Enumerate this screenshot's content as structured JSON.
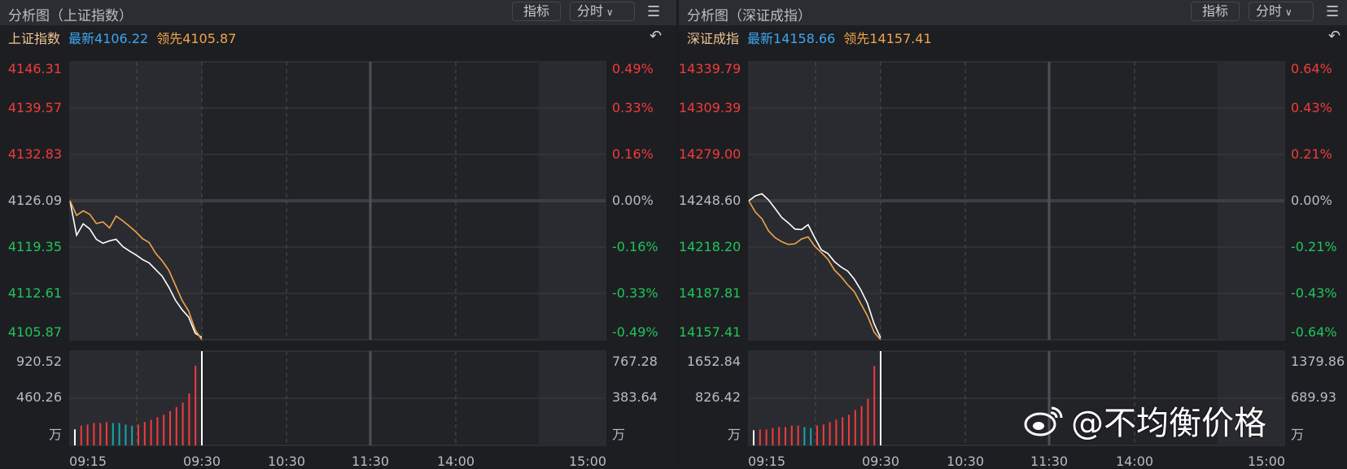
{
  "panels": [
    {
      "title": "分析图（上证指数）",
      "indicator_label": "指标",
      "period_label": "分时",
      "index_name": "上证指数",
      "latest_label": "最新4106.22",
      "leading_label": "领先4105.87",
      "price_ticks": [
        "4146.31",
        "4139.57",
        "4132.83",
        "4126.09",
        "4119.35",
        "4112.61",
        "4105.87"
      ],
      "pct_ticks": [
        "0.49%",
        "0.33%",
        "0.16%",
        "0.00%",
        "-0.16%",
        "-0.33%",
        "-0.49%"
      ],
      "vol_ticks_left": [
        "920.52",
        "460.26",
        "万"
      ],
      "vol_ticks_right": [
        "767.28",
        "383.64",
        "万"
      ]
    },
    {
      "title": "分析图（深证成指）",
      "indicator_label": "指标",
      "period_label": "分时",
      "index_name": "深证成指",
      "latest_label": "最新14158.66",
      "leading_label": "领先14157.41",
      "price_ticks": [
        "14339.79",
        "14309.39",
        "14279.00",
        "14248.60",
        "14218.20",
        "14187.81",
        "14157.41"
      ],
      "pct_ticks": [
        "0.64%",
        "0.43%",
        "0.21%",
        "0.00%",
        "-0.21%",
        "-0.43%",
        "-0.64%"
      ],
      "vol_ticks_left": [
        "1652.84",
        "826.42",
        "万"
      ],
      "vol_ticks_right": [
        "1379.86",
        "689.93",
        "万"
      ]
    }
  ],
  "time_labels": [
    "09:15",
    "09:30",
    "10:30",
    "11:30",
    "14:00",
    "15:00"
  ],
  "watermark": "@不均衡价格",
  "colors": {
    "latest": "#ffffff",
    "leading": "#f0a54a",
    "up": "#f23b3b",
    "down": "#1fc65a",
    "flat": "#12a8b0",
    "auction": "#ffffff"
  },
  "chart_data": [
    {
      "type": "line",
      "title": "上证指数",
      "x_unit": "auction step 09:15-09:30",
      "ylim": [
        4105.87,
        4146.31
      ],
      "base": 4126.09,
      "series": [
        {
          "name": "最新",
          "values": [
            4126.09,
            4121.08,
            4122.74,
            4121.99,
            4120.49,
            4119.9,
            4120.26,
            4120.49,
            4119.43,
            4118.8,
            4118.21,
            4117.54,
            4117.06,
            4116.08,
            4115.09,
            4113.51,
            4111.62,
            4110.24,
            4109.17,
            4106.81,
            4106.22
          ]
        },
        {
          "name": "领先",
          "values": [
            4126.09,
            4123.96,
            4124.63,
            4124.12,
            4122.78,
            4123.02,
            4122.15,
            4123.85,
            4123.18,
            4122.39,
            4121.56,
            4120.58,
            4120.02,
            4118.44,
            4117.34,
            4115.96,
            4113.79,
            4111.62,
            4110.04,
            4107.29,
            4105.87
          ]
        }
      ],
      "volume": {
        "ylim": [
          0,
          920.52
        ],
        "values": [
          157,
          192,
          203,
          219,
          219,
          227,
          219,
          219,
          203,
          192,
          203,
          229,
          251,
          275,
          299,
          336,
          374,
          419,
          507,
          779,
          920.52
        ],
        "colors": [
          "auction",
          "up",
          "up",
          "up",
          "up",
          "up",
          "flat",
          "flat",
          "flat",
          "flat",
          "up",
          "up",
          "up",
          "up",
          "up",
          "up",
          "up",
          "up",
          "up",
          "up",
          "auction"
        ]
      }
    },
    {
      "type": "line",
      "title": "深证成指",
      "x_unit": "auction step 09:15-09:30",
      "ylim": [
        14157.41,
        14339.79
      ],
      "base": 14248.6,
      "series": [
        {
          "name": "最新",
          "values": [
            14248.6,
            14251.78,
            14253.19,
            14249.13,
            14243.48,
            14237.64,
            14234.11,
            14230.05,
            14229.7,
            14232.88,
            14224.4,
            14216.45,
            14213.98,
            14208.67,
            14205.14,
            14202.49,
            14197.19,
            14190.12,
            14181.29,
            14168.04,
            14158.66
          ]
        },
        {
          "name": "领先",
          "values": [
            14248.6,
            14241.18,
            14236.76,
            14228.81,
            14224.39,
            14221.74,
            14219.97,
            14220.33,
            14223.51,
            14224.92,
            14218.74,
            14214.67,
            14210.26,
            14203.19,
            14198.77,
            14193.47,
            14189.02,
            14181.1,
            14173.15,
            14162.55,
            14157.41
          ]
        }
      ],
      "volume": {
        "ylim": [
          0,
          1652.84
        ],
        "values": [
          266,
          280,
          280,
          304,
          323,
          323,
          347,
          347,
          323,
          304,
          347,
          366,
          408,
          451,
          494,
          537,
          622,
          689,
          817,
          1392,
          1652.84
        ],
        "colors": [
          "auction",
          "up",
          "up",
          "up",
          "up",
          "up",
          "up",
          "up",
          "flat",
          "flat",
          "up",
          "up",
          "up",
          "up",
          "up",
          "up",
          "up",
          "up",
          "up",
          "up",
          "auction"
        ]
      }
    }
  ]
}
